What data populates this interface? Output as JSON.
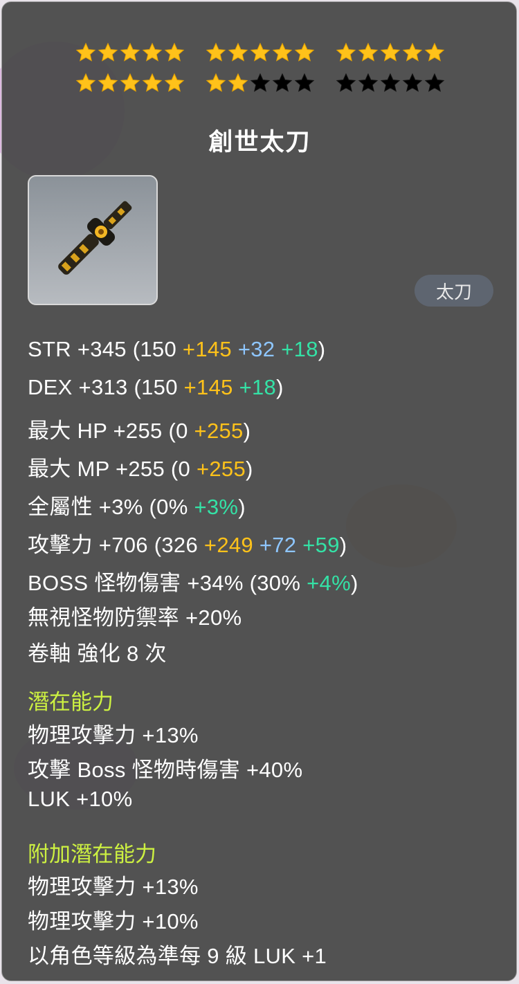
{
  "tooltip": {
    "star_rows": [
      [
        {
          "filled": 5,
          "total": 5
        },
        {
          "filled": 5,
          "total": 5
        },
        {
          "filled": 5,
          "total": 5
        }
      ],
      [
        {
          "filled": 5,
          "total": 5
        },
        {
          "filled": 2,
          "total": 5
        },
        {
          "filled": 0,
          "total": 5
        }
      ]
    ],
    "star_filled_color": "#ffc21a",
    "star_empty_color": "#000000",
    "item_name": "創世太刀",
    "icon": "weapon-katana-icon",
    "weapon_type": "太刀",
    "stats": [
      {
        "label": "STR +345 (150 ",
        "parts": [
          "+145",
          "+32",
          "+18"
        ],
        "close": ")"
      },
      {
        "label": "DEX +313 (150 ",
        "parts": [
          "+145",
          "+18"
        ],
        "close": ")"
      },
      {
        "label": "最大 HP +255 (0 ",
        "parts": [
          "+255"
        ],
        "close": ")"
      },
      {
        "label": "最大 MP +255 (0 ",
        "parts": [
          "+255"
        ],
        "close": ")"
      },
      {
        "label": "全屬性 +3% (0% ",
        "parts": [
          "+3%"
        ],
        "close": ")"
      },
      {
        "label": "攻擊力 +706  (326 ",
        "parts": [
          "+249",
          "+72",
          "+59"
        ],
        "close": ")"
      },
      {
        "label": "BOSS 怪物傷害 +34% (30% ",
        "parts": [
          "+4%"
        ],
        "close": ")"
      },
      {
        "label": "無視怪物防禦率 +20%",
        "parts": [],
        "close": ""
      },
      {
        "label": "卷軸 強化 8 次",
        "parts": [],
        "close": ""
      }
    ],
    "potential_title": "潛在能力",
    "potential": [
      "物理攻擊力 +13%",
      "攻擊 Boss 怪物時傷害 +40%",
      "LUK +10%"
    ],
    "additional_title": "附加潛在能力",
    "additional": [
      "物理攻擊力 +13%",
      "物理攻擊力 +10%",
      "以角色等級為準每 9 級 LUK +1"
    ],
    "colors": {
      "base": "#ffffff",
      "yellow": "#ffc21a",
      "blue": "#8ec6ff",
      "green": "#34e2a6",
      "section": "#cdf141"
    }
  }
}
